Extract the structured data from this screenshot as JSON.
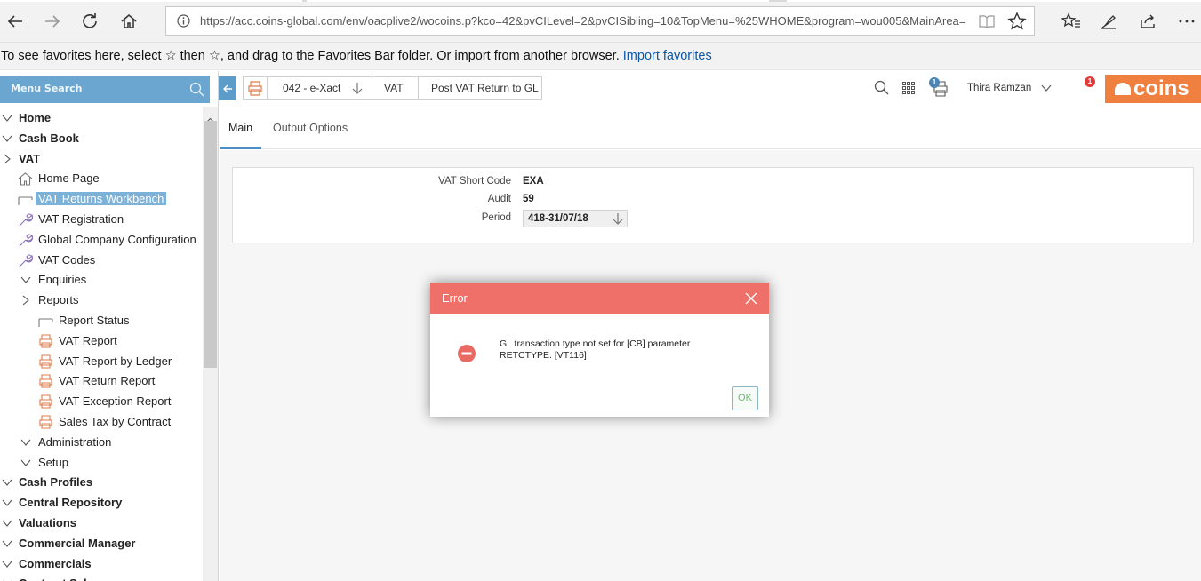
{
  "browser": {
    "url": "https://acc.coins-global.com/env/oacplive2/wocoins.p?kco=42&pvCILevel=2&pvCISibling=10&TopMenu=%25WHOME&program=wou005&MainArea=",
    "favorites_text": "To see favorites here, select ☆ then ☆, and drag to the Favorites Bar folder. Or import from another browser. ",
    "favorites_link": "Import favorites"
  },
  "sidebar": {
    "search_label": "Menu Search",
    "items": [
      {
        "label": "Home"
      },
      {
        "label": "Cash Book"
      },
      {
        "label": "VAT"
      },
      {
        "label": "Home Page"
      },
      {
        "label": "VAT Returns Workbench"
      },
      {
        "label": "VAT Registration"
      },
      {
        "label": "Global Company Configuration"
      },
      {
        "label": "VAT Codes"
      },
      {
        "label": "Enquiries"
      },
      {
        "label": "Reports"
      },
      {
        "label": "Report Status"
      },
      {
        "label": "VAT Report"
      },
      {
        "label": "VAT Report by Ledger"
      },
      {
        "label": "VAT Return Report"
      },
      {
        "label": "VAT Exception Report"
      },
      {
        "label": "Sales Tax by Contract"
      },
      {
        "label": "Administration"
      },
      {
        "label": "Setup"
      },
      {
        "label": "Cash Profiles"
      },
      {
        "label": "Central Repository"
      },
      {
        "label": "Valuations"
      },
      {
        "label": "Commercial Manager"
      },
      {
        "label": "Commercials"
      },
      {
        "label": "Contract Sales"
      }
    ]
  },
  "toolbar": {
    "company": "042 - e-Xact",
    "module": "VAT",
    "page": "Post VAT Return to GL",
    "user": "Thira Ramzan",
    "print_badge": "1",
    "notify_badge": "1",
    "logo": "coins"
  },
  "tabs": [
    {
      "label": "Main"
    },
    {
      "label": "Output Options"
    }
  ],
  "form": {
    "vat_short_code_label": "VAT Short Code",
    "vat_short_code": "EXA",
    "audit_label": "Audit",
    "audit": "59",
    "period_label": "Period",
    "period": "418-31/07/18"
  },
  "dialog": {
    "title": "Error",
    "message_line1": "GL transaction type not set for [CB] parameter",
    "message_line2": "RETCTYPE. [VT116]",
    "ok_label": "OK"
  },
  "colors": {
    "menu_blue": "#6aa6cf",
    "error_header": "#ee7068",
    "brand_orange": "#f08040"
  }
}
